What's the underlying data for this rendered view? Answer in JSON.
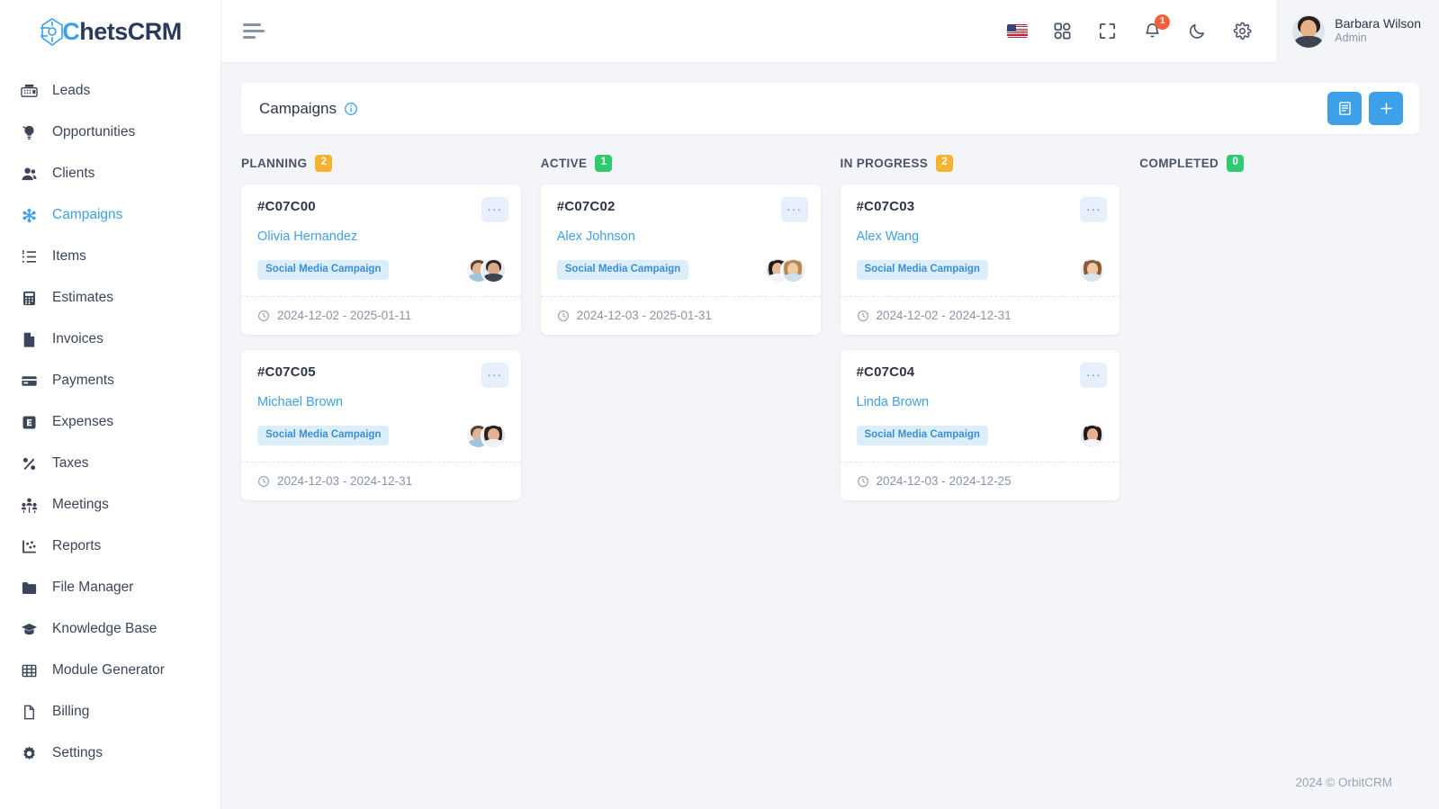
{
  "brand": {
    "name_prefix": "C",
    "name": "hetsCRM",
    "accent": "#3ea0e8"
  },
  "sidebar": {
    "items": [
      {
        "label": "Leads",
        "icon": "fax-icon",
        "active": false
      },
      {
        "label": "Opportunities",
        "icon": "lightbulb-icon",
        "active": false
      },
      {
        "label": "Clients",
        "icon": "users-icon",
        "active": false
      },
      {
        "label": "Campaigns",
        "icon": "asterisk-icon",
        "active": true
      },
      {
        "label": "Items",
        "icon": "list-icon",
        "active": false
      },
      {
        "label": "Estimates",
        "icon": "calculator-icon",
        "active": false
      },
      {
        "label": "Invoices",
        "icon": "document-icon",
        "active": false
      },
      {
        "label": "Payments",
        "icon": "credit-card-icon",
        "active": false
      },
      {
        "label": "Expenses",
        "icon": "expense-icon",
        "active": false
      },
      {
        "label": "Taxes",
        "icon": "percent-icon",
        "active": false
      },
      {
        "label": "Meetings",
        "icon": "group-icon",
        "active": false
      },
      {
        "label": "Reports",
        "icon": "chart-icon",
        "active": false
      },
      {
        "label": "File Manager",
        "icon": "folder-icon",
        "active": false
      },
      {
        "label": "Knowledge Base",
        "icon": "graduation-cap-icon",
        "active": false
      },
      {
        "label": "Module Generator",
        "icon": "grid-table-icon",
        "active": false
      },
      {
        "label": "Billing",
        "icon": "file-icon",
        "active": false
      },
      {
        "label": "Settings",
        "icon": "gear-icon",
        "active": false
      }
    ]
  },
  "topbar": {
    "menu_toggle": "hamburger-icon",
    "icons": [
      {
        "name": "language-flag-us",
        "label": "US"
      },
      {
        "name": "apps-grid-icon",
        "label": ""
      },
      {
        "name": "fullscreen-icon",
        "label": ""
      },
      {
        "name": "notifications-bell-icon",
        "label": "",
        "badge": "1"
      },
      {
        "name": "dark-mode-moon-icon",
        "label": ""
      },
      {
        "name": "settings-gear-icon",
        "label": ""
      }
    ],
    "notification_count": "1",
    "notification_badge_color": "#f4603e",
    "profile": {
      "name": "Barbara Wilson",
      "role": "Admin"
    }
  },
  "page": {
    "title": "Campaigns",
    "info_tooltip_icon": "info-circle-icon",
    "actions": [
      {
        "name": "list-view-button",
        "glyph": "list"
      },
      {
        "name": "add-campaign-button",
        "glyph": "plus"
      }
    ]
  },
  "board": {
    "columns": [
      {
        "title": "PLANNING",
        "count": "2",
        "badge_color": "#f5b32e",
        "cards": [
          {
            "id": "#C07C00",
            "person": "Olivia Hernandez",
            "tag": "Social Media Campaign",
            "date_range": "2024-12-02 - 2025-01-11",
            "menu": "···",
            "avatars": [
              {
                "name": "avatar-man-beard",
                "skin": "#e0b496",
                "hair": "#5a4130",
                "shirt": "#9fc6e0",
                "bg": "#eef1f5"
              },
              {
                "name": "avatar-man-dark-suit",
                "skin": "#dcab8a",
                "hair": "#2e2620",
                "shirt": "#3a4352",
                "bg": "#e6e9ef"
              }
            ]
          },
          {
            "id": "#C07C05",
            "person": "Michael Brown",
            "tag": "Social Media Campaign",
            "date_range": "2024-12-03 - 2024-12-31",
            "menu": "···",
            "avatars": [
              {
                "name": "avatar-man-beard",
                "skin": "#e0b496",
                "hair": "#55402f",
                "shirt": "#9fc6e0",
                "bg": "#eef1f5"
              },
              {
                "name": "avatar-woman-dark-hair",
                "skin": "#e2b292",
                "hair": "#2a1f19",
                "shirt": "#f0f2f6",
                "bg": "#dfe3ea"
              }
            ]
          }
        ]
      },
      {
        "title": "ACTIVE",
        "count": "1",
        "badge_color": "#2ecb71",
        "cards": [
          {
            "id": "#C07C02",
            "person": "Alex Johnson",
            "tag": "Social Media Campaign",
            "date_range": "2024-12-03 - 2025-01-31",
            "menu": "···",
            "avatars": [
              {
                "name": "avatar-woman-dark-hair",
                "skin": "#e6bb9b",
                "hair": "#221a15",
                "shirt": "#f4f5f8",
                "bg": "#cfd5df"
              },
              {
                "name": "avatar-woman-blonde",
                "skin": "#edcaa9",
                "hair": "#b9884f",
                "shirt": "#cfe0ee",
                "bg": "#e9edf2"
              }
            ]
          }
        ]
      },
      {
        "title": "IN PROGRESS",
        "count": "2",
        "badge_color": "#f5b32e",
        "cards": [
          {
            "id": "#C07C03",
            "person": "Alex Wang",
            "tag": "Social Media Campaign",
            "date_range": "2024-12-02 - 2024-12-31",
            "menu": "···",
            "avatars": [
              {
                "name": "avatar-woman-brown-hair",
                "skin": "#eec9a8",
                "hair": "#8a5c36",
                "shirt": "#d9e6f2",
                "bg": "#e7ecf2"
              }
            ]
          },
          {
            "id": "#C07C04",
            "person": "Linda Brown",
            "tag": "Social Media Campaign",
            "date_range": "2024-12-03 - 2024-12-25",
            "menu": "···",
            "avatars": [
              {
                "name": "avatar-woman-dark-hair",
                "skin": "#e2b493",
                "hair": "#241b16",
                "shirt": "#f2f4f7",
                "bg": "#dfe4eb"
              }
            ]
          }
        ]
      },
      {
        "title": "COMPLETED",
        "count": "0",
        "badge_color": "#2ecb71",
        "cards": []
      }
    ]
  },
  "footer": {
    "copyright": "2024 © OrbitCRM"
  }
}
